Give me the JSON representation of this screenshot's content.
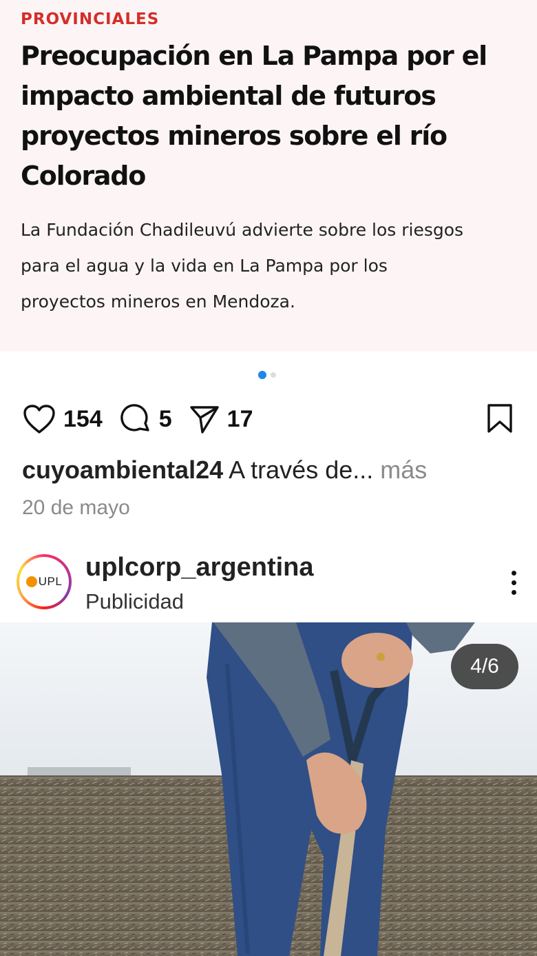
{
  "article": {
    "kicker": "PROVINCIALES",
    "headline": "Preocupación en La Pampa por el impacto ambiental de futuros proyectos mineros sobre el río Colorado",
    "summary_lines": [
      "La Fundación Chadileuvú advierte sobre los riesgos",
      "para el agua y la vida en La Pampa por los",
      "proyectos mineros en Mendoza."
    ]
  },
  "carousel": {
    "total": 2,
    "active": 1
  },
  "actions": {
    "likes": "154",
    "comments": "5",
    "shares": "17",
    "icons": [
      "heart-icon",
      "comment-icon",
      "share-icon",
      "bookmark-icon"
    ]
  },
  "post": {
    "username": "cuyoambiental24",
    "caption": "A través de...",
    "more": "más",
    "date": "20 de mayo"
  },
  "ad": {
    "username": "uplcorp_argentina",
    "label": "Publicidad",
    "logo_text": "UPL",
    "pager": "4/6"
  },
  "colors": {
    "kicker": "#d42e2a",
    "article_bg": "#fdf5f5",
    "dot_active": "#1e88e5",
    "logo_orange": "#f39200"
  }
}
